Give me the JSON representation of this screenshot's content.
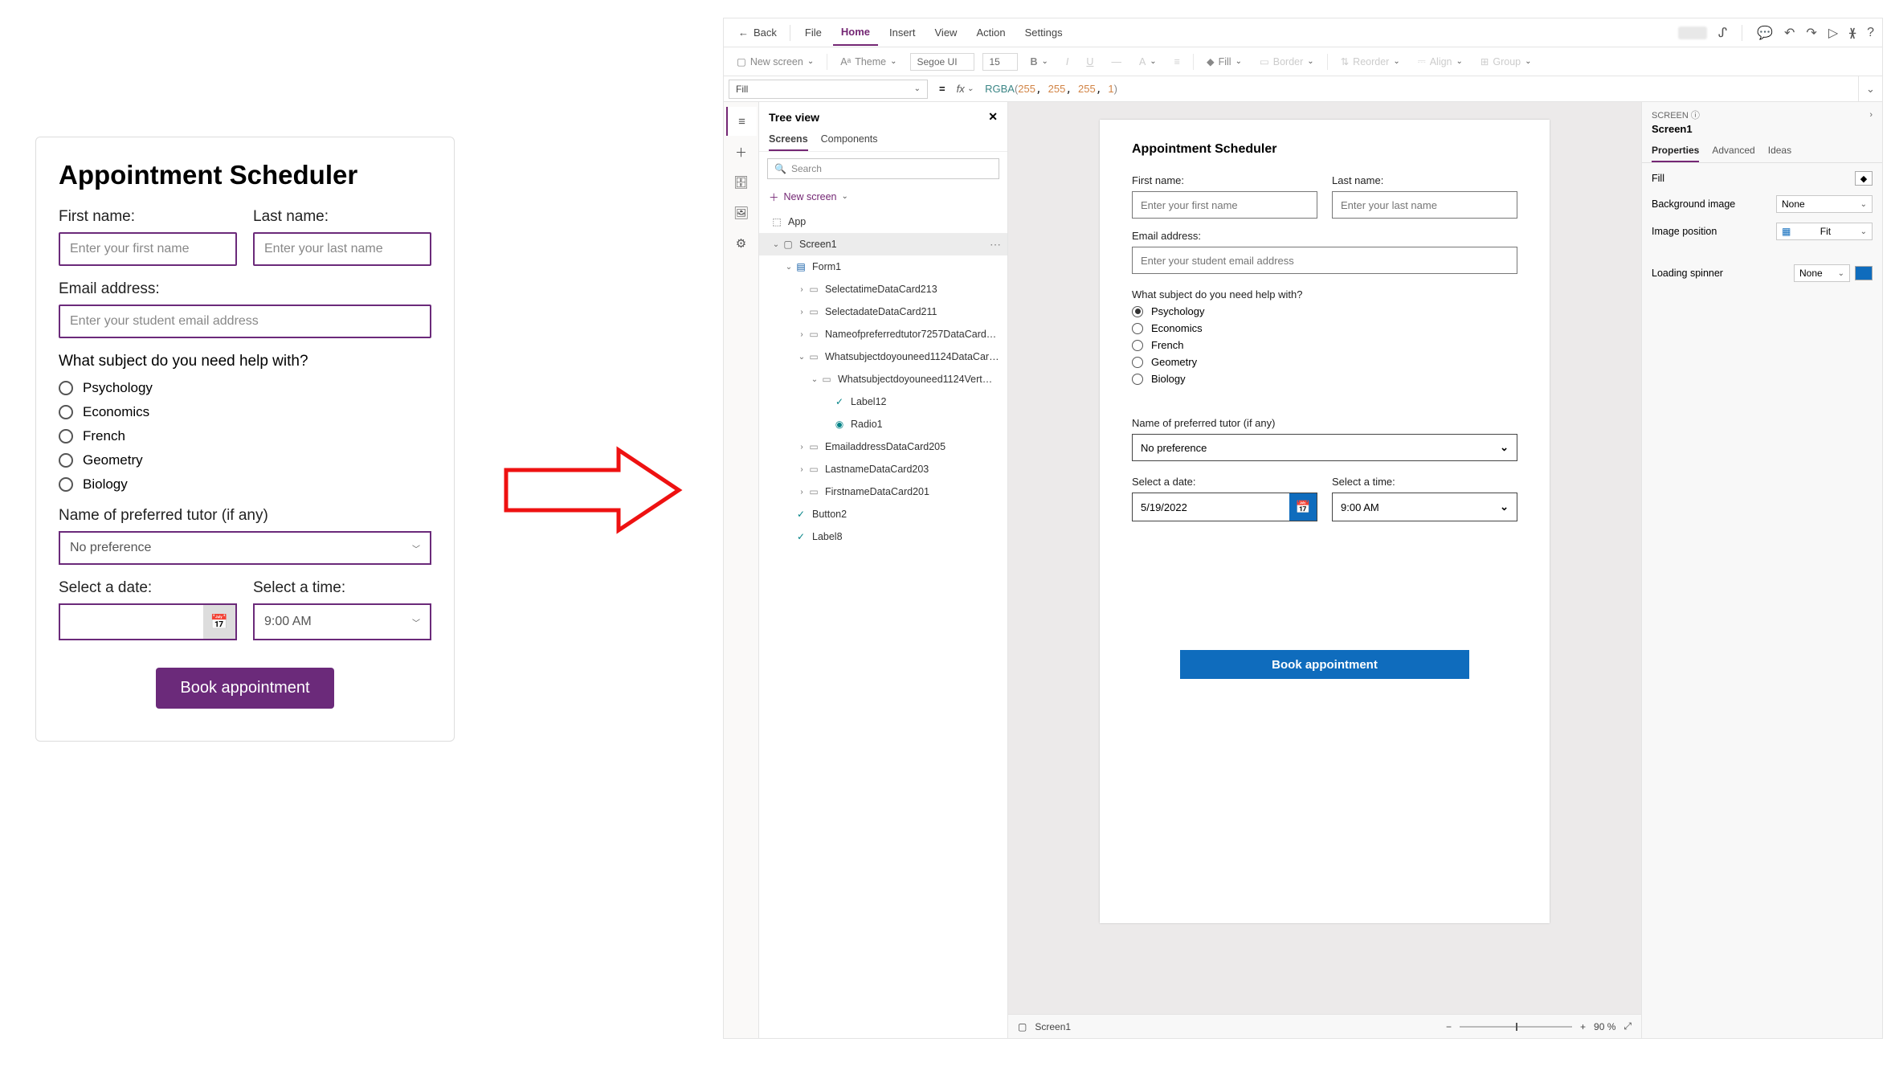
{
  "mock": {
    "title": "Appointment Scheduler",
    "first_label": "First name:",
    "last_label": "Last name:",
    "first_ph": "Enter your first name",
    "last_ph": "Enter your last name",
    "email_label": "Email address:",
    "email_ph": "Enter your student email address",
    "subject_q": "What subject do you need help with?",
    "subjects": [
      "Psychology",
      "Economics",
      "French",
      "Geometry",
      "Biology"
    ],
    "tutor_label": "Name of preferred tutor (if any)",
    "tutor_value": "No preference",
    "date_label": "Select a date:",
    "time_label": "Select a time:",
    "time_value": "9:00 AM",
    "book": "Book appointment"
  },
  "editor": {
    "menu": {
      "back": "Back",
      "file": "File",
      "home": "Home",
      "insert": "Insert",
      "view": "View",
      "action": "Action",
      "settings": "Settings"
    },
    "toolbar": {
      "new_screen": "New screen",
      "theme": "Theme",
      "font": "Segoe UI",
      "size": "15",
      "fill": "Fill",
      "border": "Border",
      "reorder": "Reorder",
      "align": "Align",
      "group": "Group"
    },
    "formula": {
      "prop": "Fill",
      "value_fn": "RGBA",
      "value_args": [
        "255",
        "255",
        "255",
        "1"
      ]
    },
    "tree": {
      "title": "Tree view",
      "tabs": {
        "screens": "Screens",
        "components": "Components"
      },
      "search_ph": "Search",
      "new_screen": "New screen",
      "nodes": {
        "app": "App",
        "screen1": "Screen1",
        "form1": "Form1",
        "c1": "SelectatimeDataCard213",
        "c2": "SelectadateDataCard211",
        "c3": "Nameofpreferredtutor7257DataCard…",
        "c4": "Whatsubjectdoyouneed1124DataCar…",
        "c4a": "Whatsubjectdoyouneed1124Vert…",
        "c4a1": "Label12",
        "c4a2": "Radio1",
        "c5": "EmailaddressDataCard205",
        "c6": "LastnameDataCard203",
        "c7": "FirstnameDataCard201",
        "btn": "Button2",
        "lbl": "Label8"
      }
    },
    "canvas": {
      "title": "Appointment Scheduler",
      "first_label": "First name:",
      "last_label": "Last name:",
      "first_ph": "Enter your first name",
      "last_ph": "Enter your last name",
      "email_label": "Email address:",
      "email_ph": "Enter your student email address",
      "subject_q": "What subject do you need help with?",
      "subjects": [
        "Psychology",
        "Economics",
        "French",
        "Geometry",
        "Biology"
      ],
      "selected_subject": "Psychology",
      "tutor_label": "Name of preferred tutor (if any)",
      "tutor_value": "No preference",
      "date_label": "Select a date:",
      "date_value": "5/19/2022",
      "time_label": "Select a time:",
      "time_value": "9:00 AM",
      "book": "Book appointment",
      "footer_screen": "Screen1",
      "zoom": "90 %"
    },
    "props": {
      "head": "SCREEN",
      "title": "Screen1",
      "tabs": {
        "properties": "Properties",
        "advanced": "Advanced",
        "ideas": "Ideas"
      },
      "rows": {
        "fill": "Fill",
        "bg": "Background image",
        "bg_val": "None",
        "imgpos": "Image position",
        "imgpos_val": "Fit",
        "spinner": "Loading spinner",
        "spinner_val": "None"
      }
    }
  }
}
